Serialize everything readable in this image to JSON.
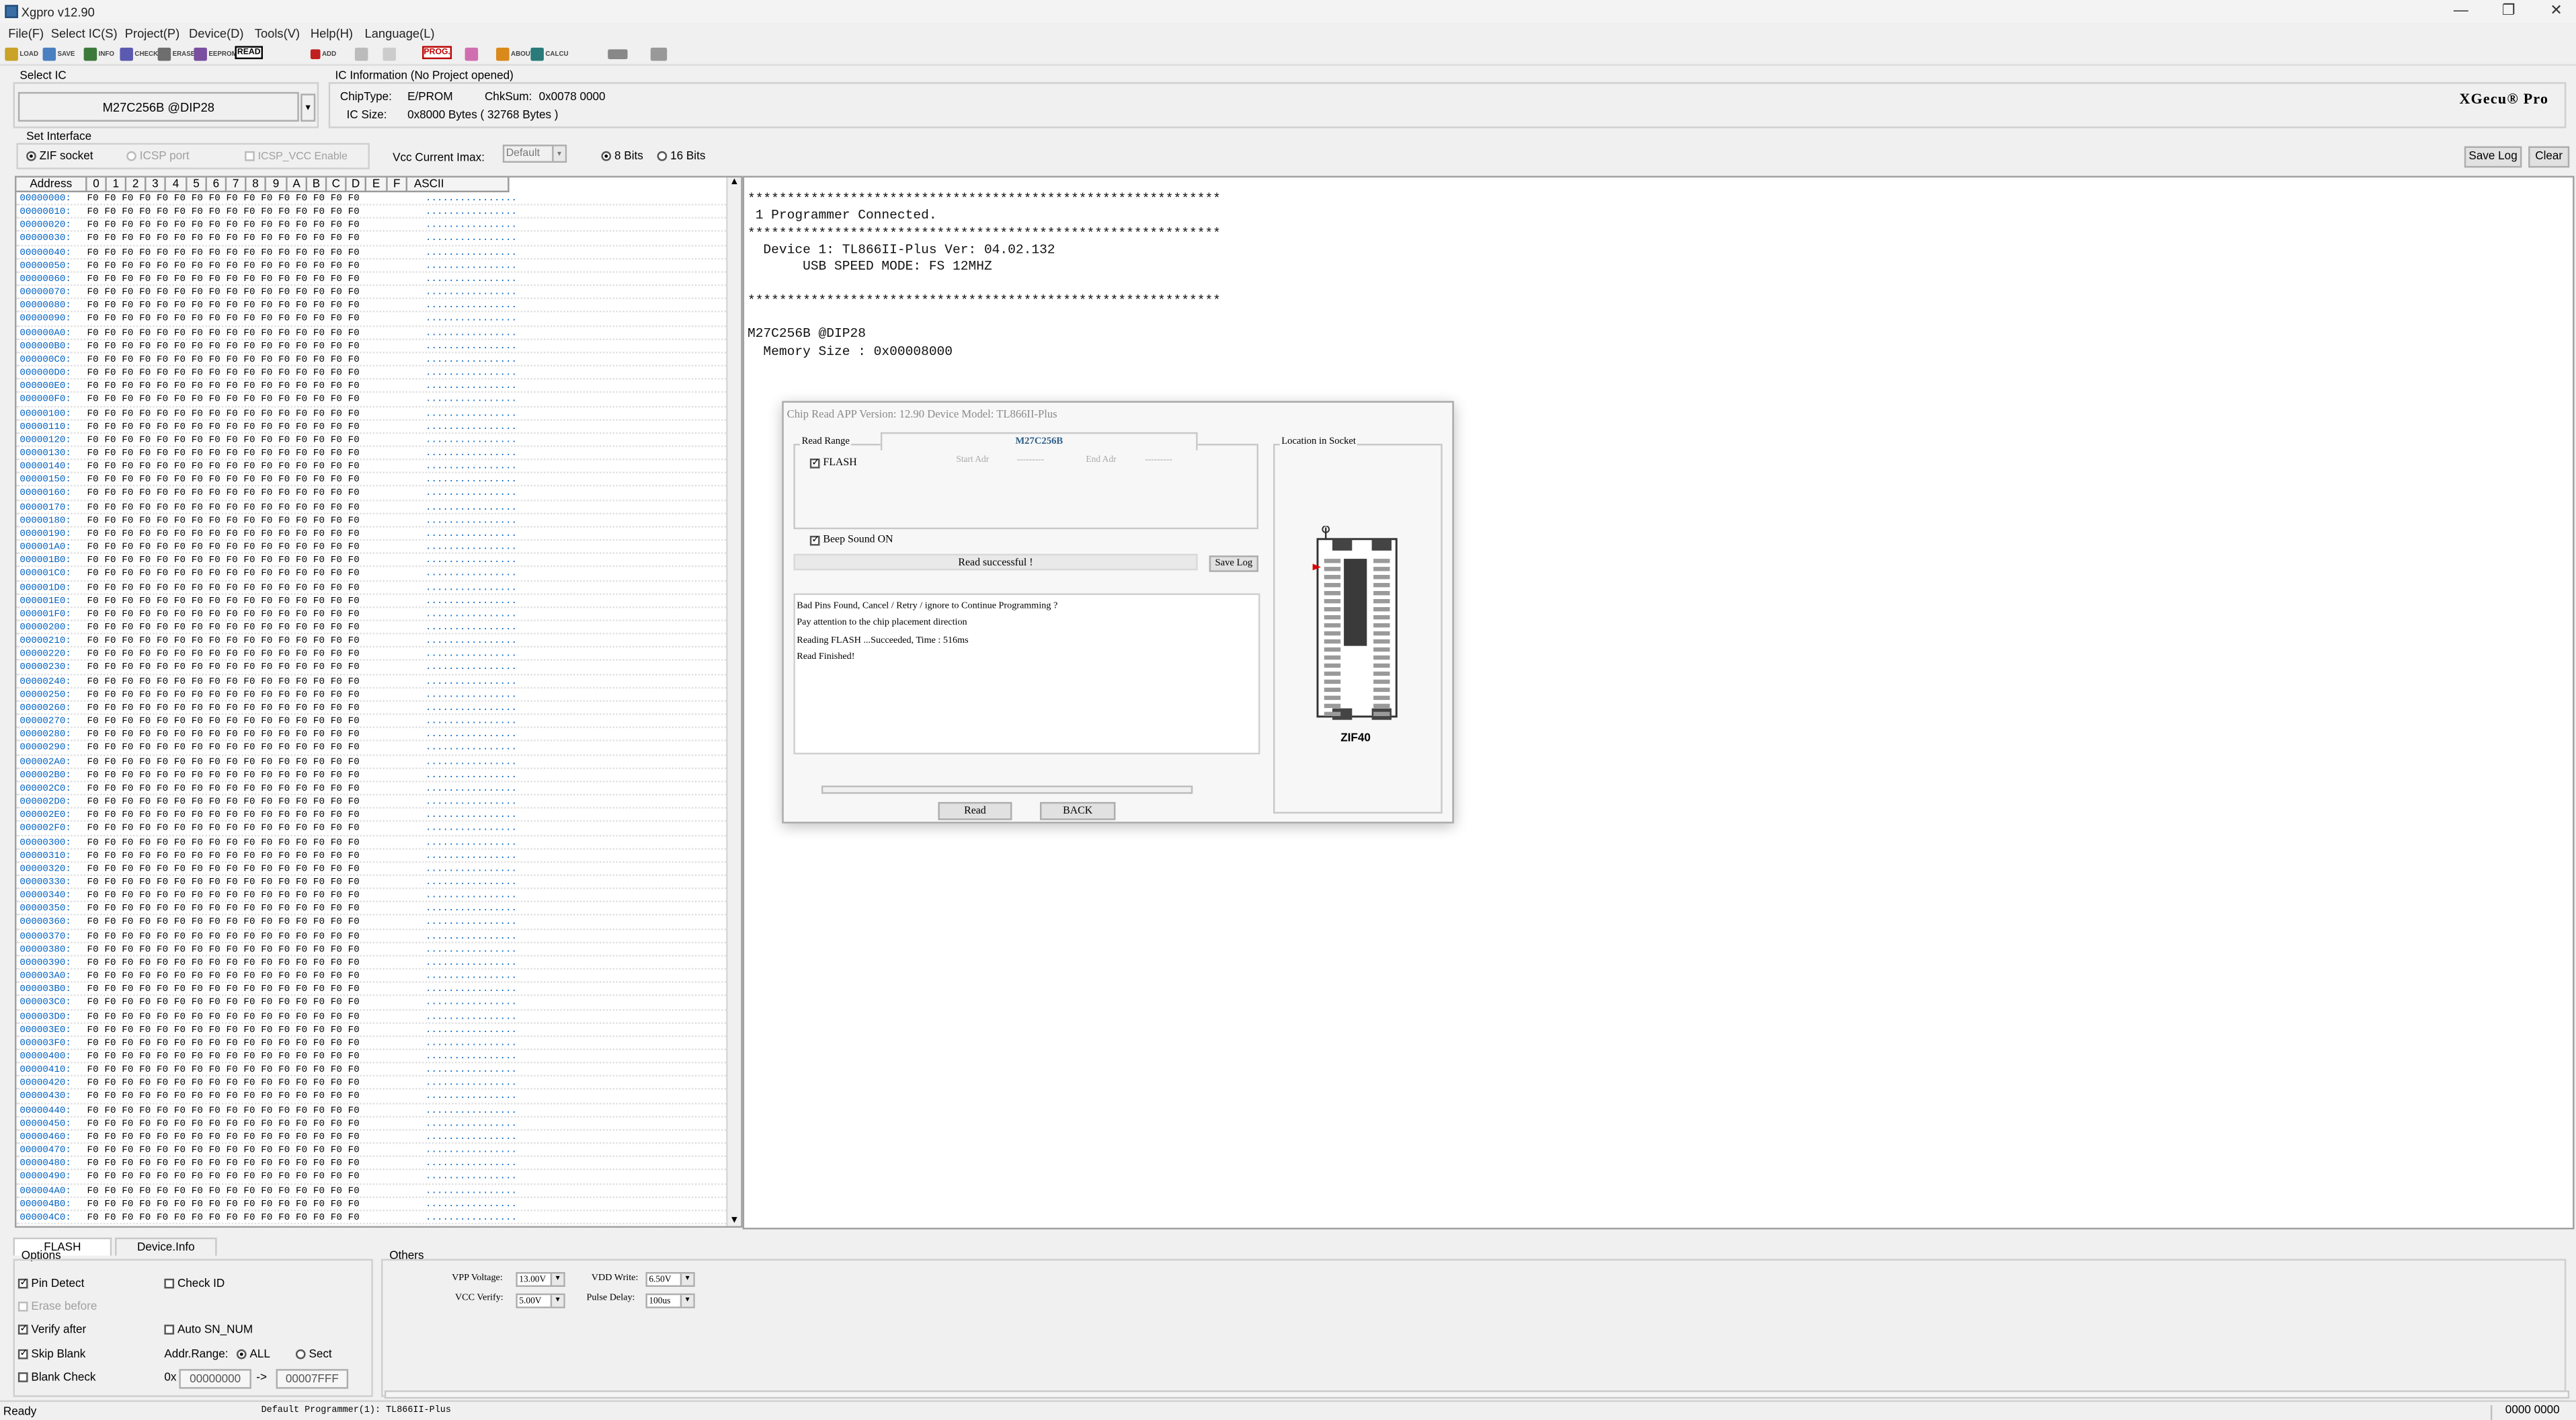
{
  "window": {
    "title": "Xgpro v12.90",
    "controls": [
      "—",
      "❐",
      "✕"
    ]
  },
  "menu": [
    "File(F)",
    "Select IC(S)",
    "Project(P)",
    "Device(D)",
    "Tools(V)",
    "Help(H)",
    "Language(L)"
  ],
  "toolbar": {
    "load": "LOAD",
    "save": "SAVE",
    "info": "INFO",
    "check": "CHECK",
    "erase": "ERASE",
    "eeprom": "EEPROM",
    "read": "READ",
    "add": "ADD",
    "prog": "PROG.",
    "about": "ABOUT",
    "calcu": "CALCU"
  },
  "select_ic": {
    "label": "Select IC",
    "value": "M27C256B @DIP28"
  },
  "ic_info": {
    "label": "IC Information (No Project opened)",
    "chiptype_label": "ChipType:",
    "chiptype": "E/PROM",
    "chksum_label": "ChkSum:",
    "chksum": "0x0078 0000",
    "icsize_label": "IC Size:",
    "icsize": "0x8000 Bytes ( 32768 Bytes )"
  },
  "logo": "XGecu® Pro",
  "interface": {
    "label": "Set Interface",
    "zif": "ZIF socket",
    "icsp": "ICSP port",
    "icsp_vcc": "ICSP_VCC Enable",
    "vcc_label": "Vcc Current Imax:",
    "vcc_value": "Default",
    "bits8": "8 Bits",
    "bits16": "16 Bits"
  },
  "buttons": {
    "save_log": "Save Log",
    "clear": "Clear"
  },
  "hex": {
    "headers": [
      "Address",
      "0",
      "1",
      "2",
      "3",
      "4",
      "5",
      "6",
      "7",
      "8",
      "9",
      "A",
      "B",
      "C",
      "D",
      "E",
      "F",
      "ASCII"
    ],
    "byte_value": "F0",
    "ascii": "................",
    "addresses": [
      "00000000:",
      "00000010:",
      "00000020:",
      "00000030:",
      "00000040:",
      "00000050:",
      "00000060:",
      "00000070:",
      "00000080:",
      "00000090:",
      "000000A0:",
      "000000B0:",
      "000000C0:",
      "000000D0:",
      "000000E0:",
      "000000F0:",
      "00000100:",
      "00000110:",
      "00000120:",
      "00000130:",
      "00000140:",
      "00000150:",
      "00000160:",
      "00000170:",
      "00000180:",
      "00000190:",
      "000001A0:",
      "000001B0:",
      "000001C0:",
      "000001D0:",
      "000001E0:",
      "000001F0:",
      "00000200:",
      "00000210:",
      "00000220:",
      "00000230:",
      "00000240:",
      "00000250:",
      "00000260:",
      "00000270:",
      "00000280:",
      "00000290:",
      "000002A0:",
      "000002B0:",
      "000002C0:",
      "000002D0:",
      "000002E0:",
      "000002F0:",
      "00000300:",
      "00000310:",
      "00000320:",
      "00000330:",
      "00000340:",
      "00000350:",
      "00000360:",
      "00000370:",
      "00000380:",
      "00000390:",
      "000003A0:",
      "000003B0:",
      "000003C0:",
      "000003D0:",
      "000003E0:",
      "000003F0:",
      "00000400:",
      "00000410:",
      "00000420:",
      "00000430:",
      "00000440:",
      "00000450:",
      "00000460:",
      "00000470:",
      "00000480:",
      "00000490:",
      "000004A0:",
      "000004B0:",
      "000004C0:"
    ]
  },
  "log": {
    "lines": [
      "************************************************************",
      " 1 Programmer Connected.",
      "************************************************************",
      "  Device 1: TL866II-Plus Ver: 04.02.132",
      "       USB SPEED MODE: FS 12MHZ",
      "",
      "************************************************************",
      "",
      "M27C256B @DIP28",
      "  Memory Size : 0x00008000"
    ]
  },
  "dialog": {
    "title": "Chip Read   APP Version: 12.90 Device Model: TL866II-Plus",
    "read_range": "Read Range",
    "chip_tab": "M27C256B",
    "flash": "FLASH",
    "start_adr": "Start Adr",
    "end_adr": "End Adr",
    "start_val": "---------",
    "end_val": "---------",
    "beep": "Beep Sound ON",
    "status": "Read successful !",
    "save_log": "Save Log",
    "messages": [
      "Bad Pins Found, Cancel / Retry / ignore to Continue Programming ?",
      "Pay attention to the chip placement direction",
      "Reading FLASH ...Succeeded, Time : 516ms",
      "Read Finished!"
    ],
    "read_btn": "Read",
    "back_btn": "BACK",
    "location": "Location in Socket",
    "socket": "ZIF40",
    "progress": 0
  },
  "tabs": [
    "FLASH",
    "Device.Info"
  ],
  "options": {
    "label": "Options",
    "pin_detect": "Pin Detect",
    "check_id": "Check ID",
    "erase_before": "Erase before",
    "verify_after": "Verify after",
    "auto_sn": "Auto SN_NUM",
    "skip_blank": "Skip Blank",
    "addr_range": "Addr.Range:",
    "all": "ALL",
    "sect": "Sect",
    "blank_check": "Blank Check",
    "ox": "0x",
    "addr_from": "00000000",
    "arrow": "->",
    "addr_to": "00007FFF"
  },
  "others": {
    "label": "Others",
    "vpp_label": "VPP Voltage:",
    "vpp": "13.00V",
    "vdd_label": "VDD Write:",
    "vdd": "6.50V",
    "vcc_label": "VCC Verify:",
    "vcc": "5.00V",
    "pulse_label": "Pulse Delay:",
    "pulse": "100us"
  },
  "status": {
    "left": "Ready",
    "programmer": "Default Programmer(1): TL866II-Plus",
    "right": "0000 0000"
  }
}
